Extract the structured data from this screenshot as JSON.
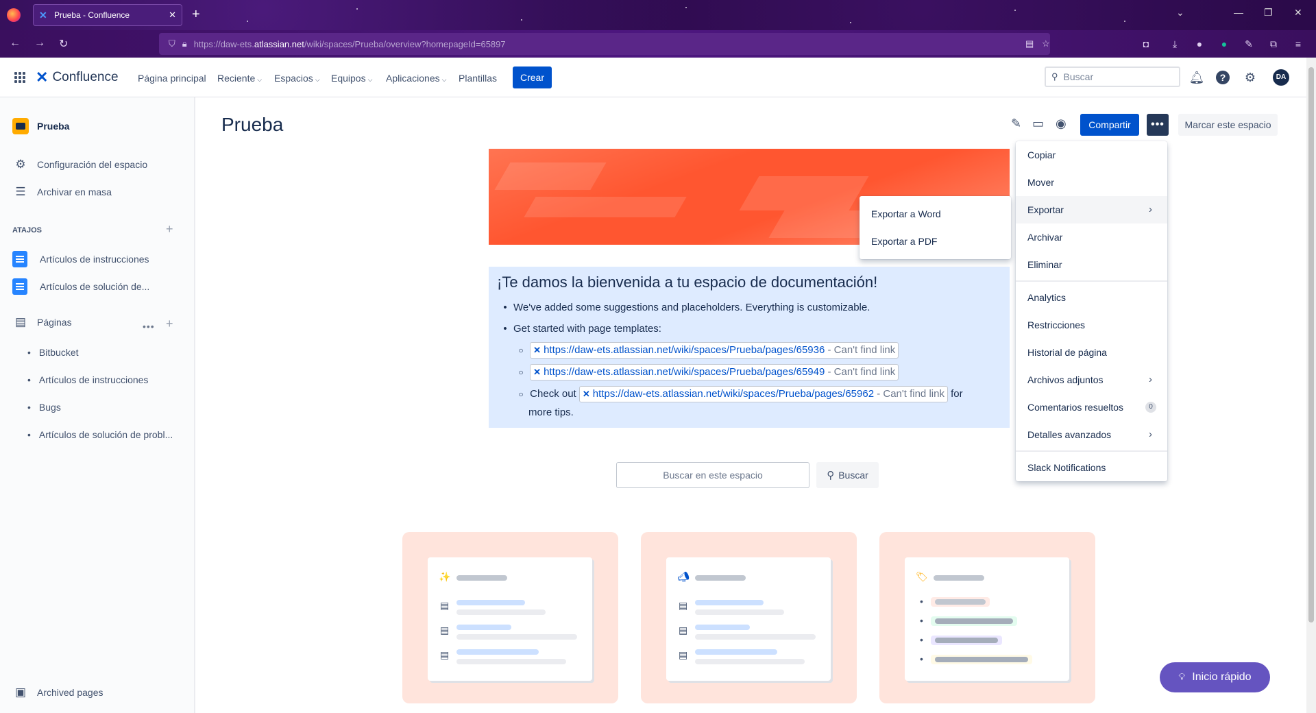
{
  "browser": {
    "tab_title": "Prueba - Confluence",
    "url_prefix": "https://daw-ets.",
    "url_domain": "atlassian.net",
    "url_path": "/wiki/spaces/Prueba/overview?homepageId=65897"
  },
  "header": {
    "product": "Confluence",
    "nav": [
      "Página principal",
      "Reciente",
      "Espacios",
      "Equipos",
      "Aplicaciones",
      "Plantillas"
    ],
    "create_label": "Crear",
    "search_placeholder": "Buscar",
    "avatar_initials": "DA"
  },
  "sidebar": {
    "space_name": "Prueba",
    "settings": "Configuración del espacio",
    "bulk_archive": "Archivar en masa",
    "shortcuts_heading": "ATAJOS",
    "shortcuts": [
      "Artículos de instrucciones",
      "Artículos de solución de..."
    ],
    "pages_label": "Páginas",
    "pages": [
      "Bitbucket",
      "Artículos de instrucciones",
      "Bugs",
      "Artículos de solución de probl..."
    ],
    "archived": "Archived pages"
  },
  "main": {
    "title": "Prueba",
    "share_label": "Compartir",
    "more_label": "•••",
    "star_label": "Marcar este espacio",
    "welcome_title": "¡Te damos la bienvenida a tu espacio de documentación!",
    "bullet1": "We've added some suggestions and placeholders. Everything is customizable.",
    "bullet2": "Get started with page templates:",
    "links": [
      "https://daw-ets.atlassian.net/wiki/spaces/Prueba/pages/65936",
      "https://daw-ets.atlassian.net/wiki/spaces/Prueba/pages/65949",
      "https://daw-ets.atlassian.net/wiki/spaces/Prueba/pages/65962"
    ],
    "link_missing": " - Can't find link",
    "check_out": "Check out",
    "for_more": "for",
    "more_tips": "more tips.",
    "space_search_placeholder": "Buscar en este espacio",
    "space_search_button": "Buscar"
  },
  "menu": {
    "items": [
      "Copiar",
      "Mover",
      "Exportar",
      "Archivar",
      "Eliminar",
      "Analytics",
      "Restricciones",
      "Historial de página",
      "Archivos adjuntos",
      "Comentarios resueltos",
      "Detalles avanzados",
      "Slack Notifications"
    ],
    "resolved_count": "0",
    "export_submenu": [
      "Exportar a Word",
      "Exportar a PDF"
    ]
  },
  "quick_start": "Inicio rápido",
  "colors": {
    "primary": "#0052cc",
    "banner": "#ff5630",
    "welcome_bg": "#deebff",
    "quick_start": "#6554c0"
  }
}
